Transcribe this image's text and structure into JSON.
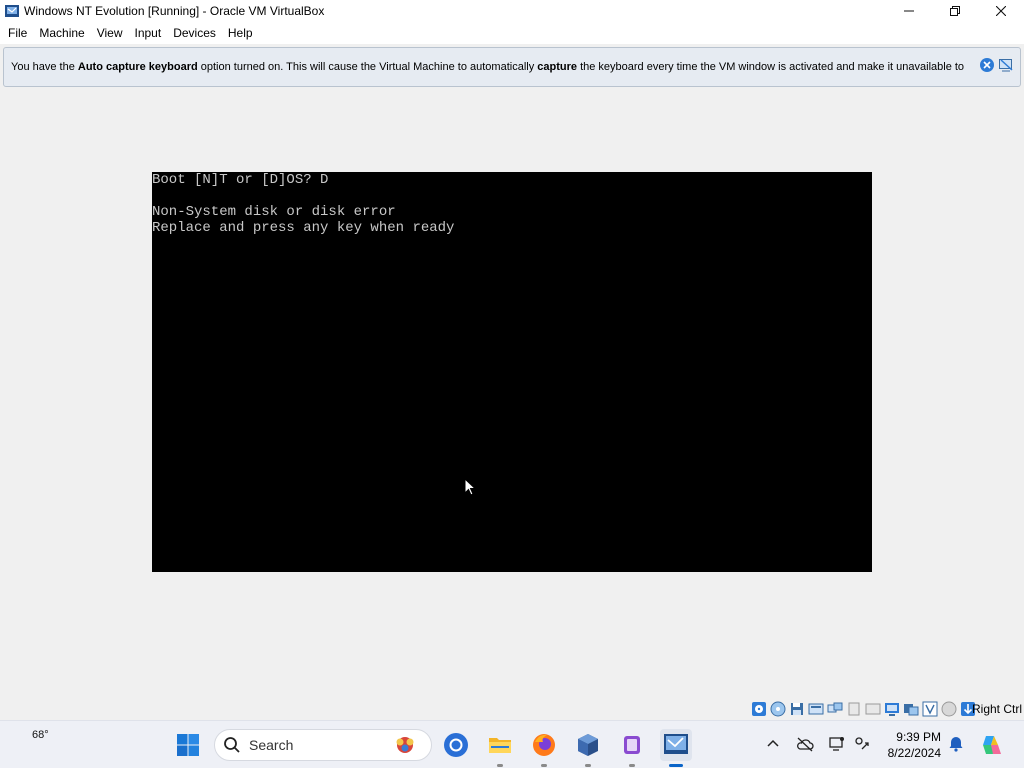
{
  "window": {
    "title": "Windows NT Evolution [Running] - Oracle VM VirtualBox"
  },
  "menu": {
    "items": [
      "File",
      "Machine",
      "View",
      "Input",
      "Devices",
      "Help"
    ]
  },
  "notice": {
    "part1": "You have the ",
    "bold1": "Auto capture keyboard",
    "part2": " option turned on. This will cause the Virtual Machine to automatically ",
    "bold2": "capture",
    "part3": " the keyboard every time the VM window is activated and make it unavailable to"
  },
  "vm_console": {
    "lines": [
      "Boot [N]T or [D]OS? D",
      "",
      "Non-System disk or disk error",
      "Replace and press any key when ready"
    ]
  },
  "statusbar": {
    "host_key": "Right Ctrl"
  },
  "taskbar": {
    "weather_temp": "68°",
    "search_placeholder": "Search",
    "clock_time": "9:39 PM",
    "clock_date": "8/22/2024"
  },
  "colors": {
    "console_text": "#c8c8c8",
    "console_bg": "#000000",
    "notice_bg": "#e6ebf2",
    "window_bg": "#f0f0f0"
  }
}
